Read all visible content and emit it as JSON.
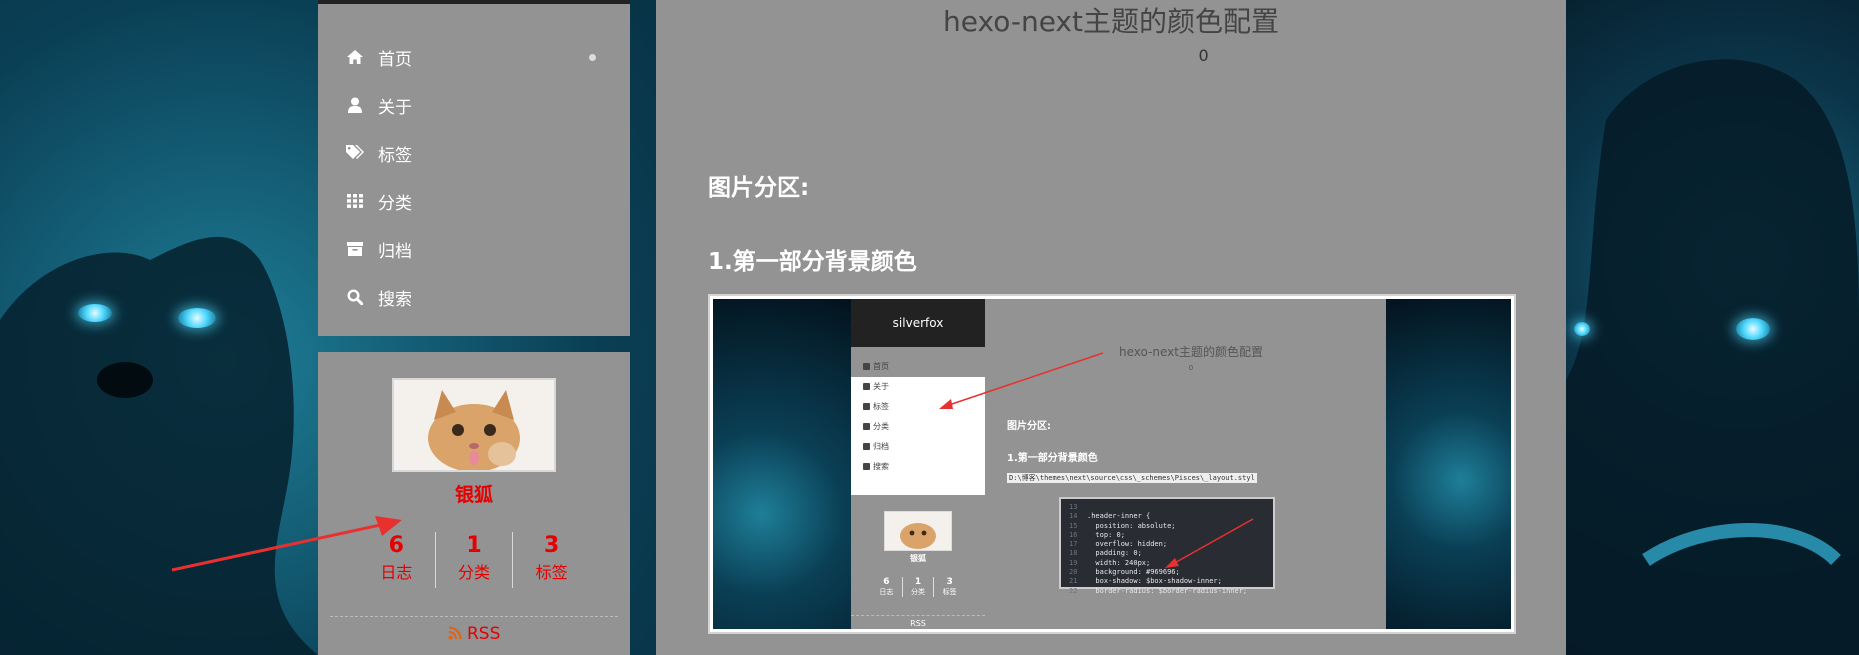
{
  "menu": {
    "items": [
      {
        "label": "首页",
        "icon": "home-icon",
        "active": true
      },
      {
        "label": "关于",
        "icon": "user-icon"
      },
      {
        "label": "标签",
        "icon": "tags-icon"
      },
      {
        "label": "分类",
        "icon": "grid-icon"
      },
      {
        "label": "归档",
        "icon": "archive-icon"
      },
      {
        "label": "搜索",
        "icon": "search-icon"
      }
    ]
  },
  "profile": {
    "author": "银狐",
    "stats": [
      {
        "num": "6",
        "label": "日志"
      },
      {
        "num": "1",
        "label": "分类"
      },
      {
        "num": "3",
        "label": "标签"
      }
    ],
    "rss": "RSS"
  },
  "post": {
    "title": "hexo-next主题的颜色配置",
    "comment_count": "0",
    "h2_1": "图片分区:",
    "h2_2": "1.第一部分背景颜色"
  },
  "screenshot": {
    "site_title": "silverfox",
    "menu": [
      "首页",
      "关于",
      "标签",
      "分类",
      "归档",
      "搜索"
    ],
    "author": "银狐",
    "stats": [
      {
        "num": "6",
        "label": "日志"
      },
      {
        "num": "1",
        "label": "分类"
      },
      {
        "num": "3",
        "label": "标签"
      }
    ],
    "rss": "RSS",
    "post_title": "hexo-next主题的颜色配置",
    "comment_count": "0",
    "h2_1": "图片分区:",
    "h2_2": "1.第一部分背景颜色",
    "path": "D:\\博客\\themes\\next\\source\\css\\_schemes\\Pisces\\_layout.styl",
    "code": [
      {
        "ln": "13",
        "text": ""
      },
      {
        "ln": "14",
        "text": ".header-inner {"
      },
      {
        "ln": "15",
        "text": "  position: absolute;"
      },
      {
        "ln": "16",
        "text": "  top: 0;"
      },
      {
        "ln": "17",
        "text": "  overflow: hidden;"
      },
      {
        "ln": "18",
        "text": "  padding: 0;"
      },
      {
        "ln": "19",
        "text": "  width: 240px;"
      },
      {
        "ln": "20",
        "text": "  background: #969696;"
      },
      {
        "ln": "21",
        "text": "  box-shadow: $box-shadow-inner;"
      },
      {
        "ln": "22",
        "text": "  border-radius: $border-radius-inner;"
      }
    ]
  },
  "colors": {
    "sidebar_bg": "#939393",
    "accent_red": "#e60000",
    "arrow_red": "#e8302f",
    "header_dark": "#222222"
  }
}
